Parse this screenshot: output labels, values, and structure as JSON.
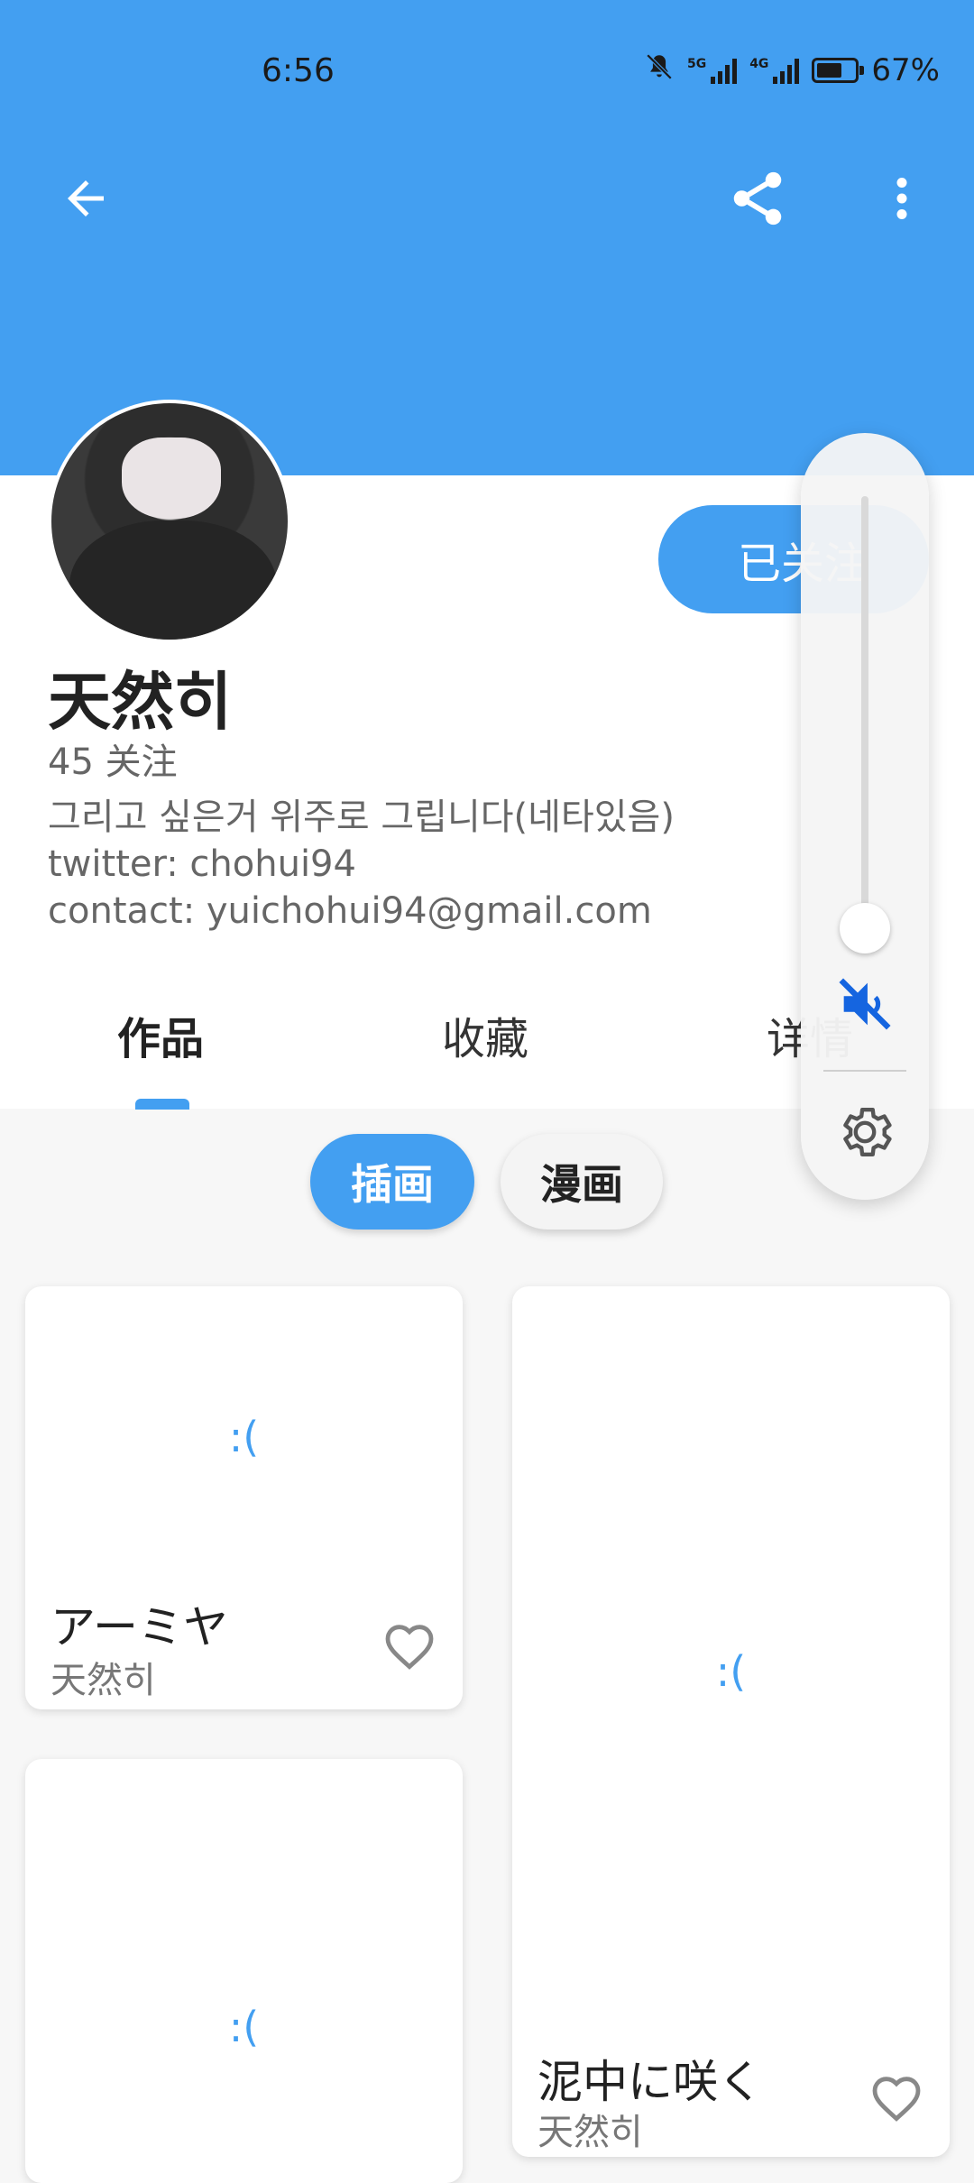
{
  "status_bar": {
    "time": "6:56",
    "battery_percent": "67%",
    "battery_level": 0.67,
    "network_labels": [
      "5G",
      "4G"
    ]
  },
  "toolbar": {
    "back_icon": "back-arrow-icon",
    "share_icon": "share-icon",
    "more_icon": "more-vert-icon",
    "accent_color": "#439ff1"
  },
  "profile": {
    "name": "天然히",
    "follow_count": "45 关注",
    "follow_button_label": "已关注",
    "bio_lines": [
      "그리고 싶은거 위주로 그립니다(네타있음)",
      "twitter: chohui94",
      "contact: yuichohui94@gmail.com"
    ]
  },
  "tabs": [
    {
      "label": "作品",
      "active": true
    },
    {
      "label": "收藏",
      "active": false
    },
    {
      "label": "详情",
      "active": false
    }
  ],
  "filter_chips": [
    {
      "label": "插画",
      "active": true
    },
    {
      "label": "漫画",
      "active": false
    }
  ],
  "works": [
    {
      "placeholder": ":(",
      "title": "アーミヤ",
      "author": "天然히"
    },
    {
      "placeholder": ":(",
      "title": "泥中に咲く",
      "author": "天然히"
    },
    {
      "placeholder": ":(",
      "title": "",
      "author": ""
    }
  ],
  "volume_panel": {
    "level": 0.0,
    "muted": true,
    "mute_icon": "speaker-muted-icon",
    "settings_icon": "gear-icon"
  }
}
